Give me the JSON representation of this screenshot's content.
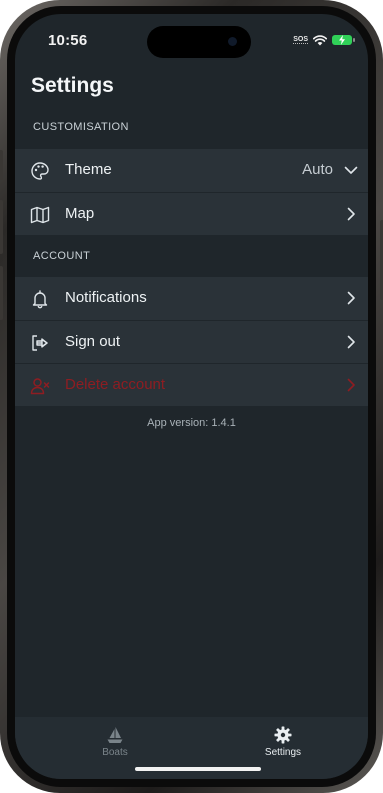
{
  "status_bar": {
    "time": "10:56",
    "sos": "SOS",
    "battery_color": "#30d158"
  },
  "page": {
    "title": "Settings"
  },
  "sections": {
    "customisation": {
      "label": "CUSTOMISATION",
      "theme": {
        "label": "Theme",
        "value": "Auto",
        "icon": "palette-icon"
      },
      "map": {
        "label": "Map",
        "icon": "map-icon"
      }
    },
    "account": {
      "label": "ACCOUNT",
      "notifications": {
        "label": "Notifications",
        "icon": "bell-icon"
      },
      "sign_out": {
        "label": "Sign out",
        "icon": "sign-out-icon"
      },
      "delete_account": {
        "label": "Delete account",
        "icon": "delete-user-icon",
        "color": "#8e1d22"
      }
    }
  },
  "app_version": "App version: 1.4.1",
  "tabbar": {
    "boats": {
      "label": "Boats",
      "icon": "sailboat-icon"
    },
    "settings": {
      "label": "Settings",
      "icon": "gear-icon"
    }
  }
}
